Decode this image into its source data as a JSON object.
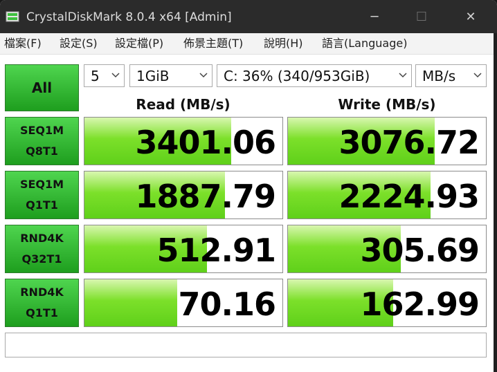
{
  "window": {
    "title": "CrystalDiskMark 8.0.4 x64 [Admin]",
    "minimize_glyph": "─",
    "maximize_glyph": "☐",
    "close_glyph": "✕"
  },
  "menu": [
    {
      "label": "檔案(F)"
    },
    {
      "label": "設定(S)"
    },
    {
      "label": "設定檔(P)"
    },
    {
      "label": "佈景主題(T)"
    },
    {
      "label": "說明(H)"
    },
    {
      "label": "語言(Language)"
    }
  ],
  "controls": {
    "all_label": "All",
    "count": "5",
    "size": "1GiB",
    "drive": "C: 36% (340/953GiB)",
    "unit": "MB/s"
  },
  "headers": {
    "read": "Read (MB/s)",
    "write": "Write (MB/s)"
  },
  "tests": [
    {
      "line1": "SEQ1M",
      "line2": "Q8T1",
      "read": "3401.06",
      "write": "3076.72",
      "read_fill": 0.74,
      "write_fill": 0.74
    },
    {
      "line1": "SEQ1M",
      "line2": "Q1T1",
      "read": "1887.79",
      "write": "2224.93",
      "read_fill": 0.71,
      "write_fill": 0.72
    },
    {
      "line1": "RND4K",
      "line2": "Q32T1",
      "read": "512.91",
      "write": "305.69",
      "read_fill": 0.62,
      "write_fill": 0.57
    },
    {
      "line1": "RND4K",
      "line2": "Q1T1",
      "read": "70.16",
      "write": "162.99",
      "read_fill": 0.47,
      "write_fill": 0.53
    }
  ],
  "status_text": "",
  "colors": {
    "accent_green": "#1e9e1e",
    "bar_green": "#7ce02a",
    "titlebar": "#2b2b2b"
  }
}
